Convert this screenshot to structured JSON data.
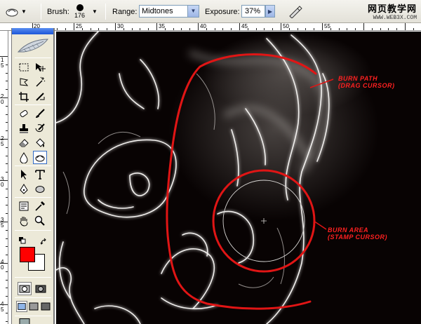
{
  "options_bar": {
    "brush_label": "Brush:",
    "brush_size": "176",
    "range_label": "Range:",
    "range_value": "Midtones",
    "exposure_label": "Exposure:",
    "exposure_value": "37%"
  },
  "watermark": {
    "line1": "网页教学网",
    "line2": "WWW.WEB3X.COM"
  },
  "ruler_top": {
    "labels": [
      "20",
      "25",
      "30",
      "35",
      "40",
      "45",
      "50",
      "55"
    ]
  },
  "ruler_left": {
    "labels": [
      "1",
      "5",
      "2",
      "0",
      "2",
      "5",
      "3",
      "0",
      "3",
      "5",
      "4",
      "0",
      "4",
      "5"
    ]
  },
  "tools": {
    "foreground_color": "#ff0000",
    "background_color": "#ffffff",
    "active_tool": "burn-tool",
    "items": [
      "marquee-tool",
      "move-tool",
      "lasso-tool",
      "magic-wand-tool",
      "crop-tool",
      "slice-tool",
      "healing-brush-tool",
      "brush-tool",
      "clone-stamp-tool",
      "history-brush-tool",
      "eraser-tool",
      "paint-bucket-tool",
      "blur-tool",
      "burn-tool",
      "path-selection-tool",
      "type-tool",
      "pen-tool",
      "shape-tool",
      "notes-tool",
      "eyedropper-tool",
      "hand-tool",
      "zoom-tool"
    ]
  },
  "canvas": {
    "annotation_burn_path": [
      "BURN PATH",
      "(DRAG CURSOR)"
    ],
    "annotation_burn_area": [
      "BURN AREA",
      "(STAMP CURSOR)"
    ],
    "annotation_color": "#e01515"
  }
}
